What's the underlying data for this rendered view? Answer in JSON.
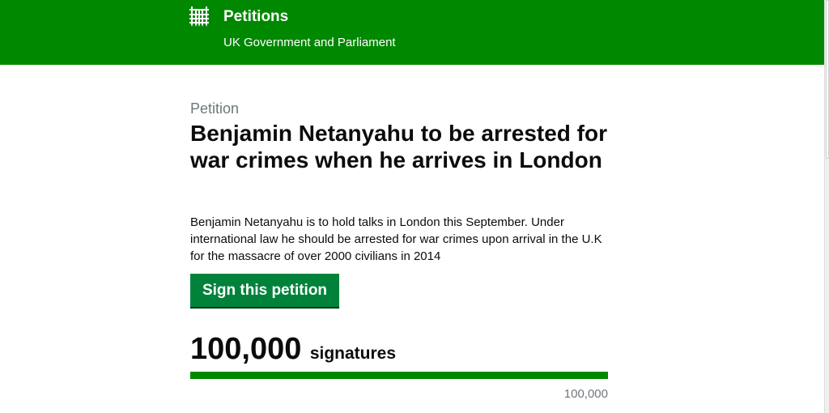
{
  "header": {
    "brand_icon": "portcullis-icon",
    "title": "Petitions",
    "subtitle": "UK Government and Parliament",
    "background_color": "#008800"
  },
  "petition": {
    "eyebrow": "Petition",
    "title": "Benjamin Netanyahu to be arrested for war crimes when he arrives in London",
    "description": "Benjamin Netanyahu is to hold talks in London this September. Under international law he should be arrested for war crimes upon arrival in the U.K for the massacre of over 2000 civilians in 2014",
    "sign_button_label": "Sign this petition",
    "button_color": "#00823b"
  },
  "signatures": {
    "count": "100,000",
    "label": "signatures",
    "threshold_label": "100,000",
    "progress_fraction": 1.0,
    "progress_color": "#008800"
  }
}
